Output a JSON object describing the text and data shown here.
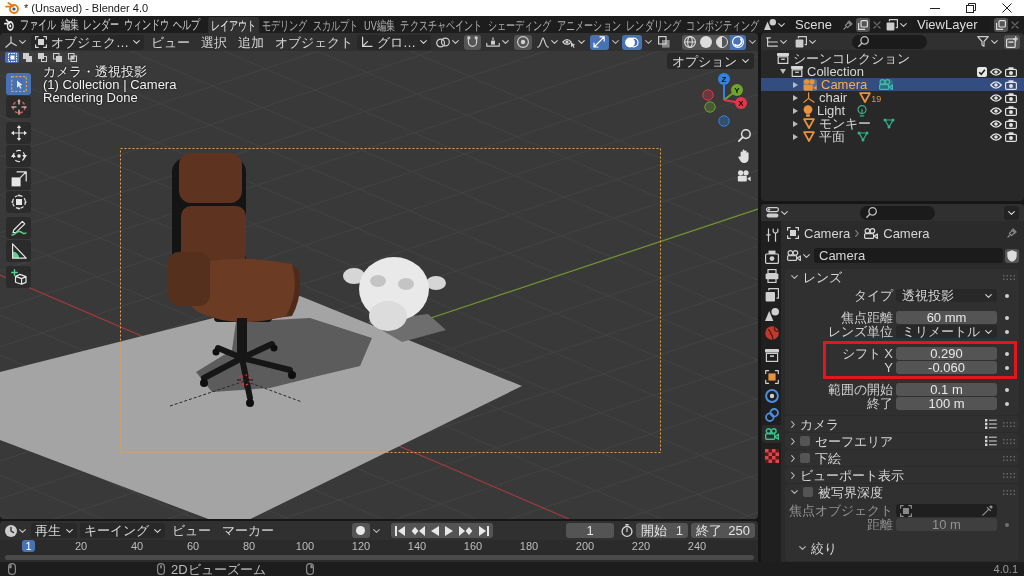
{
  "window": {
    "title": "* (Unsaved) - Blender 4.0"
  },
  "top_bar": {
    "menus": [
      "ファイル",
      "編集",
      "レンダー",
      "ウィンドウ",
      "ヘルプ"
    ],
    "workspaces": [
      {
        "label": "レイアウト",
        "selected": true
      },
      {
        "label": "モデリング",
        "selected": false
      },
      {
        "label": "スカルプト",
        "selected": false
      },
      {
        "label": "UV編集",
        "selected": false
      },
      {
        "label": "テクスチャペイント",
        "selected": false
      },
      {
        "label": "シェーディング",
        "selected": false
      },
      {
        "label": "アニメーション",
        "selected": false
      },
      {
        "label": "レンダリング",
        "selected": false
      },
      {
        "label": "コンポジティング",
        "selected": false
      }
    ],
    "scene": "Scene",
    "view_layer": "ViewLayer"
  },
  "viewport": {
    "mode": "オブジェク…",
    "menus": [
      "ビュー",
      "選択",
      "追加",
      "オブジェクト"
    ],
    "orientation": "グロ…",
    "toggles": [
      {
        "kind": "gizmos",
        "on": true
      },
      {
        "kind": "overlays",
        "on": true
      },
      {
        "kind": "xray",
        "on": false
      }
    ],
    "shading": [
      {
        "kind": "wireframe",
        "selected": false
      },
      {
        "kind": "solid",
        "selected": false
      },
      {
        "kind": "material",
        "selected": false
      },
      {
        "kind": "rendered",
        "selected": true
      }
    ],
    "select_modes": [
      {
        "kind": "set",
        "selected": true
      },
      {
        "kind": "extend",
        "selected": false
      },
      {
        "kind": "subtract",
        "selected": false
      },
      {
        "kind": "invert",
        "selected": false
      },
      {
        "kind": "intersect",
        "selected": false
      }
    ],
    "options": "オプション",
    "tool_groups": [
      {
        "tools": [
          {
            "kind": "select",
            "selected": true
          },
          {
            "kind": "cursor",
            "selected": false
          }
        ]
      },
      {
        "tools": [
          {
            "kind": "move",
            "selected": false
          },
          {
            "kind": "rotate",
            "selected": false
          },
          {
            "kind": "scale",
            "selected": false
          },
          {
            "kind": "transform",
            "selected": false
          }
        ]
      },
      {
        "tools": [
          {
            "kind": "annotate",
            "selected": false
          },
          {
            "kind": "measure",
            "selected": false
          }
        ]
      },
      {
        "tools": [
          {
            "kind": "add_cube",
            "selected": false
          }
        ]
      }
    ],
    "info": [
      "カメラ・透視投影",
      "(1) Collection | Camera",
      "Rendering Done"
    ],
    "axes": [
      {
        "kind": "z",
        "label": "Z",
        "color": "#2f83e3"
      },
      {
        "kind": "y",
        "label": "Y",
        "color": "#6ea52a"
      },
      {
        "kind": "x",
        "label": "X",
        "color": "#e5354b"
      }
    ]
  },
  "outliner": {
    "root": "シーンコレクション",
    "items": [
      {
        "name": "Collection",
        "kind": "collection",
        "checked": true,
        "expanded": true,
        "selected": false,
        "children": [
          {
            "name": "Camera",
            "kind": "camera",
            "expanded": false,
            "selected": true
          },
          {
            "name": "chair",
            "kind": "empty",
            "expanded": false,
            "selected": false,
            "badge": "19"
          },
          {
            "name": "Light",
            "kind": "light",
            "expanded": false,
            "selected": false
          },
          {
            "name": "モンキー",
            "kind": "mesh",
            "expanded": false,
            "selected": false
          },
          {
            "name": "平面",
            "kind": "mesh",
            "expanded": false,
            "selected": false
          }
        ]
      }
    ]
  },
  "properties": {
    "tab_groups": [
      {
        "tabs": [
          {
            "kind": "tool",
            "selected": false
          }
        ]
      },
      {
        "tabs": [
          {
            "kind": "render",
            "selected": false
          },
          {
            "kind": "output",
            "selected": false
          },
          {
            "kind": "view_layer",
            "selected": false
          },
          {
            "kind": "scene",
            "selected": false
          },
          {
            "kind": "world",
            "selected": false
          }
        ]
      },
      {
        "tabs": [
          {
            "kind": "collection",
            "selected": false
          }
        ]
      },
      {
        "tabs": [
          {
            "kind": "object",
            "selected": false
          },
          {
            "kind": "physics",
            "selected": false
          },
          {
            "kind": "constraints",
            "selected": false
          },
          {
            "kind": "data",
            "selected": true
          }
        ]
      },
      {
        "tabs": [
          {
            "kind": "texture",
            "selected": false
          }
        ]
      }
    ],
    "breadcrumb": [
      {
        "kind": "object",
        "label": "Camera"
      },
      {
        "kind": "data",
        "label": "Camera"
      }
    ],
    "datablock": "Camera",
    "panels": [
      {
        "title": "レンズ",
        "expanded": true,
        "groups": [
          {
            "highlighted": false,
            "fields": [
              {
                "label": "タイプ",
                "value": "透視投影",
                "kind": "dropdown",
                "disabled": false
              }
            ]
          },
          {
            "highlighted": false,
            "fields": [
              {
                "label": "焦点距離",
                "value": "60 mm",
                "kind": "number",
                "disabled": false
              },
              {
                "label": "レンズ単位",
                "value": "ミリメートル",
                "kind": "dropdown",
                "disabled": false
              }
            ]
          },
          {
            "highlighted": true,
            "fields": [
              {
                "label": "シフト X",
                "value": "0.290",
                "kind": "number",
                "disabled": false
              },
              {
                "label": "Y",
                "value": "-0.060",
                "kind": "number",
                "disabled": false
              }
            ]
          },
          {
            "highlighted": false,
            "fields": [
              {
                "label": "範囲の開始",
                "value": "0.1 m",
                "kind": "number",
                "disabled": false
              },
              {
                "label": "終了",
                "value": "100 m",
                "kind": "number",
                "disabled": false
              }
            ]
          }
        ]
      },
      {
        "title": "カメラ",
        "expanded": false,
        "presets": true
      },
      {
        "title": "セーフエリア",
        "expanded": false,
        "checked": false,
        "presets": true
      },
      {
        "title": "下絵",
        "expanded": false,
        "checked": false
      },
      {
        "title": "ビューポート表示",
        "expanded": false
      },
      {
        "title": "被写界深度",
        "expanded": true,
        "checked": false,
        "groups": [
          {
            "highlighted": false,
            "fields": [
              {
                "label": "焦点オブジェクト",
                "kind": "object",
                "disabled": true
              },
              {
                "label": "距離",
                "value": "10 m",
                "kind": "number",
                "disabled": true
              }
            ]
          }
        ],
        "subpanels": [
          {
            "title": "絞り",
            "expanded": true
          }
        ]
      }
    ]
  },
  "timeline": {
    "menus": [
      {
        "label": "再生",
        "kind": "dropdown"
      },
      {
        "label": "キーイング",
        "kind": "dropdown"
      },
      {
        "label": "ビュー",
        "kind": "menu"
      },
      {
        "label": "マーカー",
        "kind": "menu"
      }
    ],
    "auto_keying": false,
    "current_frame": "1",
    "start": {
      "label": "開始",
      "value": "1"
    },
    "end": {
      "label": "終了",
      "value": "250"
    },
    "playhead": "1",
    "ticks": [
      "20",
      "40",
      "60",
      "80",
      "100",
      "120",
      "140",
      "160",
      "180",
      "200",
      "220",
      "240"
    ]
  },
  "status_bar": {
    "hints": [
      {
        "kind": "left"
      },
      {
        "kind": "middle",
        "text": "2Dビューズーム"
      },
      {
        "kind": "right"
      }
    ],
    "version": "4.0.1"
  }
}
